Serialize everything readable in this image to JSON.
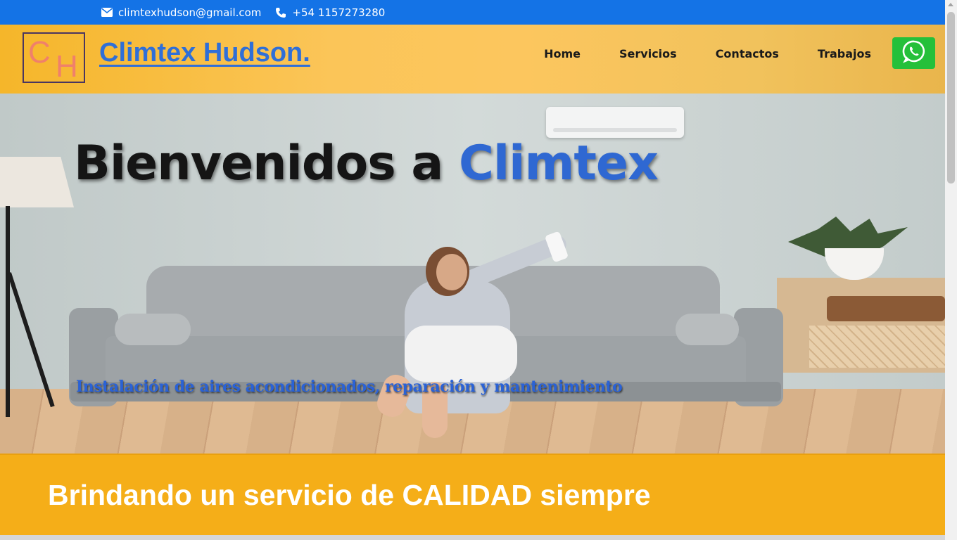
{
  "topbar": {
    "email": "climtexhudson@gmail.com",
    "phone": "+54 1157273280",
    "email_icon": "envelope-icon",
    "phone_icon": "phone-icon",
    "background_color": "#1473e6"
  },
  "header": {
    "logo": {
      "letter_1": "C",
      "letter_2": "H"
    },
    "brand": "Climtex Hudson.",
    "nav": [
      {
        "label": "Home"
      },
      {
        "label": "Servicios"
      },
      {
        "label": "Contactos"
      },
      {
        "label": "Trabajos"
      }
    ],
    "whatsapp_icon": "whatsapp-icon",
    "brand_color": "#2f6fd8",
    "whatsapp_color": "#25c03a"
  },
  "hero": {
    "title_part_1": "Bienvenidos a ",
    "title_part_2": "Climtex",
    "subtitle": "Instalación de aires acondicionados, reparación y mantenimiento",
    "accent_color": "#2f68d2"
  },
  "quality": {
    "heading": "Brindando un servicio de CALIDAD siempre",
    "background_color": "#f5ae18"
  }
}
